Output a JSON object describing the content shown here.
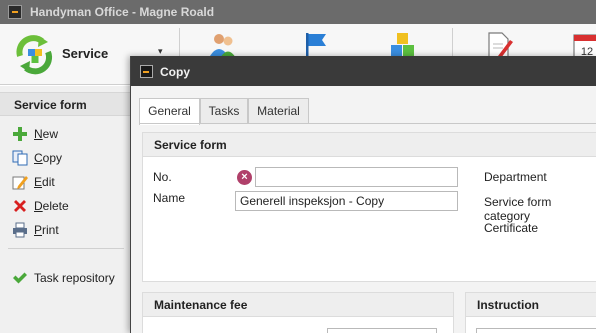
{
  "window": {
    "title": "Handyman Office - Magne Roald"
  },
  "ribbon": {
    "service_label": "Service",
    "caret": "▾",
    "icons": [
      "people-icon",
      "flag-icon",
      "cubes-icon",
      "document-pen-icon",
      "calendar-icon"
    ]
  },
  "sidebar": {
    "header": "Service form",
    "items": [
      {
        "label": "New",
        "icon": "plus-icon"
      },
      {
        "label": "Copy",
        "icon": "copy-icon"
      },
      {
        "label": "Edit",
        "icon": "edit-icon"
      },
      {
        "label": "Delete",
        "icon": "delete-icon"
      },
      {
        "label": "Print",
        "icon": "print-icon"
      }
    ],
    "task_repository": "Task repository"
  },
  "dialog": {
    "title": "Copy",
    "tabs": [
      {
        "label": "General"
      },
      {
        "label": "Tasks"
      },
      {
        "label": "Material"
      }
    ],
    "service_form": {
      "header": "Service form",
      "no_label": "No.",
      "no_value": "",
      "error_glyph": "×",
      "name_label": "Name",
      "name_value": "Generell inspeksjon - Copy",
      "department_label": "Department",
      "category_label": "Service form category",
      "certificate_label": "Certificate"
    },
    "maintenance_fee": {
      "header": "Maintenance fee"
    },
    "instruction": {
      "header": "Instruction"
    }
  },
  "colors": {
    "titlebar": "#6b6b6b",
    "dialog_title": "#3a3a3a",
    "error": "#b0406a",
    "accent_green": "#4aa83a"
  }
}
